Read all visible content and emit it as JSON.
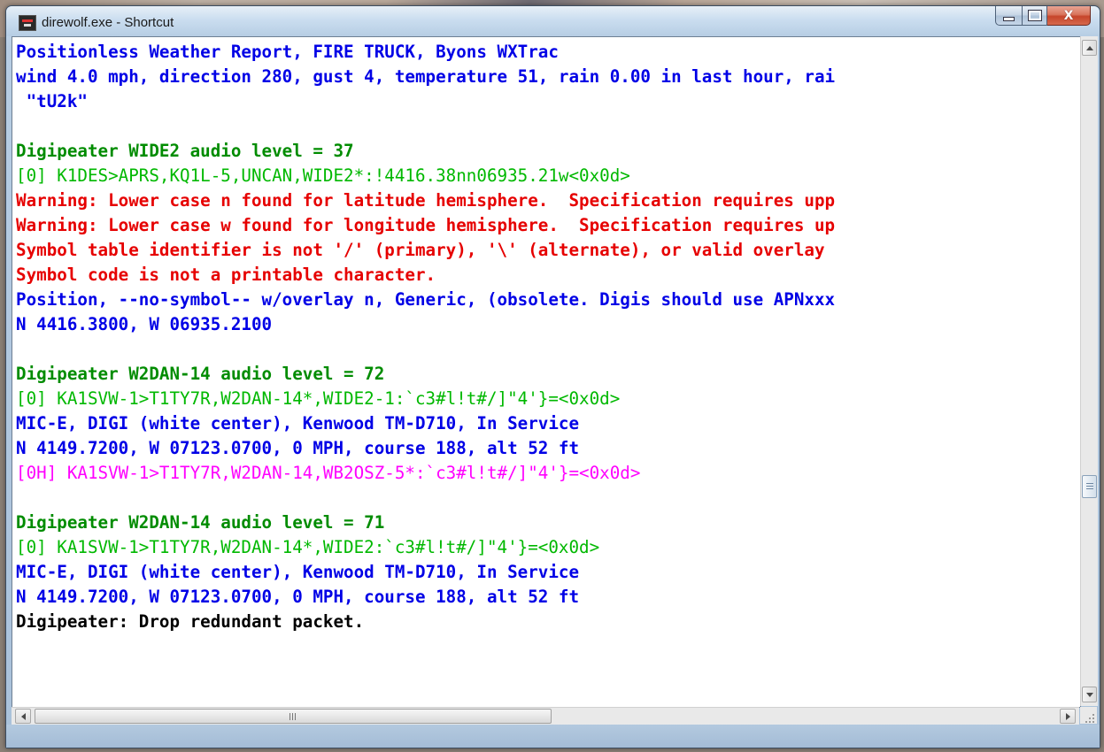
{
  "window": {
    "title": "direwolf.exe - Shortcut",
    "close_glyph": "X"
  },
  "console": {
    "lines": [
      {
        "text": "Positionless Weather Report, FIRE TRUCK, Byons WXTrac",
        "style": "blue"
      },
      {
        "text": "wind 4.0 mph, direction 280, gust 4, temperature 51, rain 0.00 in last hour, rai",
        "style": "blue"
      },
      {
        "text": " \"tU2k\"",
        "style": "blue"
      },
      {
        "text": "",
        "style": "blue"
      },
      {
        "text": "Digipeater WIDE2 audio level = 37",
        "style": "green"
      },
      {
        "text": "[0] K1DES>APRS,KQ1L-5,UNCAN,WIDE2*:!4416.38nn06935.21w<0x0d>",
        "style": "lgreen"
      },
      {
        "text": "Warning: Lower case n found for latitude hemisphere.  Specification requires upp",
        "style": "red"
      },
      {
        "text": "Warning: Lower case w found for longitude hemisphere.  Specification requires up",
        "style": "red"
      },
      {
        "text": "Symbol table identifier is not '/' (primary), '\\' (alternate), or valid overlay",
        "style": "red"
      },
      {
        "text": "Symbol code is not a printable character.",
        "style": "red"
      },
      {
        "text": "Position, --no-symbol-- w/overlay n, Generic, (obsolete. Digis should use APNxxx",
        "style": "blue"
      },
      {
        "text": "N 4416.3800, W 06935.2100",
        "style": "blue"
      },
      {
        "text": "",
        "style": "blue"
      },
      {
        "text": "Digipeater W2DAN-14 audio level = 72",
        "style": "green"
      },
      {
        "text": "[0] KA1SVW-1>T1TY7R,W2DAN-14*,WIDE2-1:`c3#l!t#/]\"4'}=<0x0d>",
        "style": "lgreen"
      },
      {
        "text": "MIC-E, DIGI (white center), Kenwood TM-D710, In Service",
        "style": "blue"
      },
      {
        "text": "N 4149.7200, W 07123.0700, 0 MPH, course 188, alt 52 ft",
        "style": "blue"
      },
      {
        "text": "[0H] KA1SVW-1>T1TY7R,W2DAN-14,WB2OSZ-5*:`c3#l!t#/]\"4'}=<0x0d>",
        "style": "magenta"
      },
      {
        "text": "",
        "style": "blue"
      },
      {
        "text": "Digipeater W2DAN-14 audio level = 71",
        "style": "green"
      },
      {
        "text": "[0] KA1SVW-1>T1TY7R,W2DAN-14*,WIDE2:`c3#l!t#/]\"4'}=<0x0d>",
        "style": "lgreen"
      },
      {
        "text": "MIC-E, DIGI (white center), Kenwood TM-D710, In Service",
        "style": "blue"
      },
      {
        "text": "N 4149.7200, W 07123.0700, 0 MPH, course 188, alt 52 ft",
        "style": "blue"
      },
      {
        "text": "Digipeater: Drop redundant packet.",
        "style": "black"
      }
    ]
  },
  "colors": {
    "blue": "#0000e6",
    "green": "#008c00",
    "light_green": "#00b800",
    "red": "#e60000",
    "magenta": "#ff00ff",
    "black": "#000000"
  },
  "scrollbars": {
    "vertical_position": 0.62,
    "horizontal_position": 0.0,
    "horizontal_visible_fraction": 0.5
  }
}
